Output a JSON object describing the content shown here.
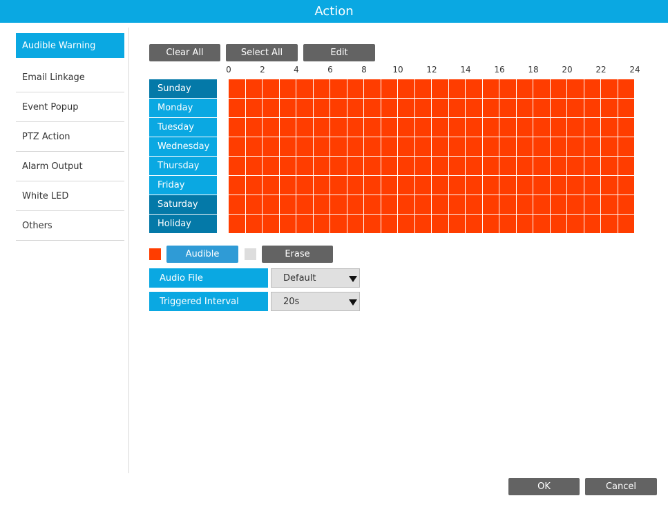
{
  "title": "Action",
  "sidebar": {
    "items": [
      {
        "label": "Audible Warning",
        "active": true
      },
      {
        "label": "Email Linkage"
      },
      {
        "label": "Event Popup"
      },
      {
        "label": "PTZ Action"
      },
      {
        "label": "Alarm Output"
      },
      {
        "label": "White LED"
      },
      {
        "label": "Others"
      }
    ]
  },
  "toolbar": {
    "clear_all": "Clear All",
    "select_all": "Select All",
    "edit": "Edit"
  },
  "schedule": {
    "hour_labels": [
      "0",
      "2",
      "4",
      "6",
      "8",
      "10",
      "12",
      "14",
      "16",
      "18",
      "20",
      "22",
      "24"
    ],
    "days": [
      "Sunday",
      "Monday",
      "Tuesday",
      "Wednesday",
      "Thursday",
      "Friday",
      "Saturday",
      "Holiday"
    ],
    "all_slots_state": "audible",
    "colors": {
      "audible": "#ff3d00",
      "erase": "#dddddd",
      "accent": "#0aa8e2",
      "day_dark": "#0479a8"
    }
  },
  "legend": {
    "audible_label": "Audible",
    "erase_label": "Erase"
  },
  "fields": {
    "audio_file_label": "Audio File",
    "audio_file_value": "Default",
    "triggered_interval_label": "Triggered Interval",
    "triggered_interval_value": "20s"
  },
  "footer": {
    "ok": "OK",
    "cancel": "Cancel"
  }
}
